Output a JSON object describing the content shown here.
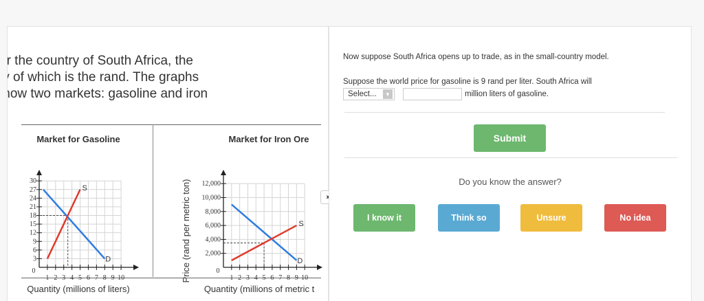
{
  "intro": {
    "line1": "er the country of South Africa, the",
    "line2": ":y of which is the rand. The graphs",
    "line3": ";how two markets: gasoline and iron"
  },
  "gas_chart": {
    "title": "Market for Gasoline",
    "xlabel": "Quantity (millions of liters)",
    "supply_label": "S",
    "demand_label": "D"
  },
  "iron_chart": {
    "title": "Market for Iron Ore",
    "xlabel": "Quantity (millions of metric t",
    "ylabel": "Price (rand per metric ton)",
    "supply_label": "S",
    "demand_label": "D"
  },
  "chart_data": [
    {
      "type": "line",
      "title": "Market for Gasoline",
      "xlabel": "Quantity (millions of liters)",
      "ylabel": "",
      "x_ticks": [
        1,
        2,
        3,
        4,
        5,
        6,
        7,
        8,
        9,
        10
      ],
      "y_ticks": [
        3,
        6,
        9,
        12,
        15,
        18,
        21,
        24,
        27,
        30
      ],
      "xlim": [
        0,
        11
      ],
      "ylim": [
        0,
        31
      ],
      "series": [
        {
          "name": "S",
          "color": "#e03a2b",
          "x": [
            1,
            5
          ],
          "y": [
            3,
            27
          ]
        },
        {
          "name": "D",
          "color": "#2f7de0",
          "x": [
            0.5,
            8
          ],
          "y": [
            27,
            3
          ]
        }
      ],
      "equilibrium": {
        "x": 3.5,
        "y": 18
      }
    },
    {
      "type": "line",
      "title": "Market for Iron Ore",
      "xlabel": "Quantity (millions of metric t",
      "ylabel": "Price (rand per metric ton)",
      "x_ticks": [
        1,
        2,
        3,
        4,
        5,
        6,
        7,
        8,
        9,
        10
      ],
      "y_ticks": [
        2000,
        4000,
        6000,
        8000,
        10000,
        12000
      ],
      "y_tick_labels": [
        "2,000",
        "4,000",
        "6,000",
        "8,000",
        "10,000",
        "12,000"
      ],
      "xlim": [
        0,
        11
      ],
      "ylim": [
        0,
        12800
      ],
      "series": [
        {
          "name": "S",
          "color": "#e03a2b",
          "x": [
            1,
            9
          ],
          "y": [
            1000,
            6000
          ]
        },
        {
          "name": "D",
          "color": "#2f7de0",
          "x": [
            1,
            9
          ],
          "y": [
            9000,
            1000
          ]
        }
      ],
      "equilibrium": {
        "x": 5,
        "y": 3500
      }
    }
  ],
  "toggle_label": "›‹",
  "right": {
    "q1": "Now suppose South Africa opens up to trade, as in the small-country model.",
    "q2": "Suppose the world price for gasoline is 9 rand per liter. South Africa will",
    "select_value": "Select...",
    "select_arrow": "▼",
    "after_input": "million liters of gasoline.",
    "submit_label": "Submit",
    "prompt": "Do you know the answer?",
    "buttons": [
      {
        "label": "I know it",
        "color": "#6db76e"
      },
      {
        "label": "Think so",
        "color": "#5aa9d3"
      },
      {
        "label": "Unsure",
        "color": "#f0bc3e"
      },
      {
        "label": "No idea",
        "color": "#dd5a55"
      }
    ]
  }
}
